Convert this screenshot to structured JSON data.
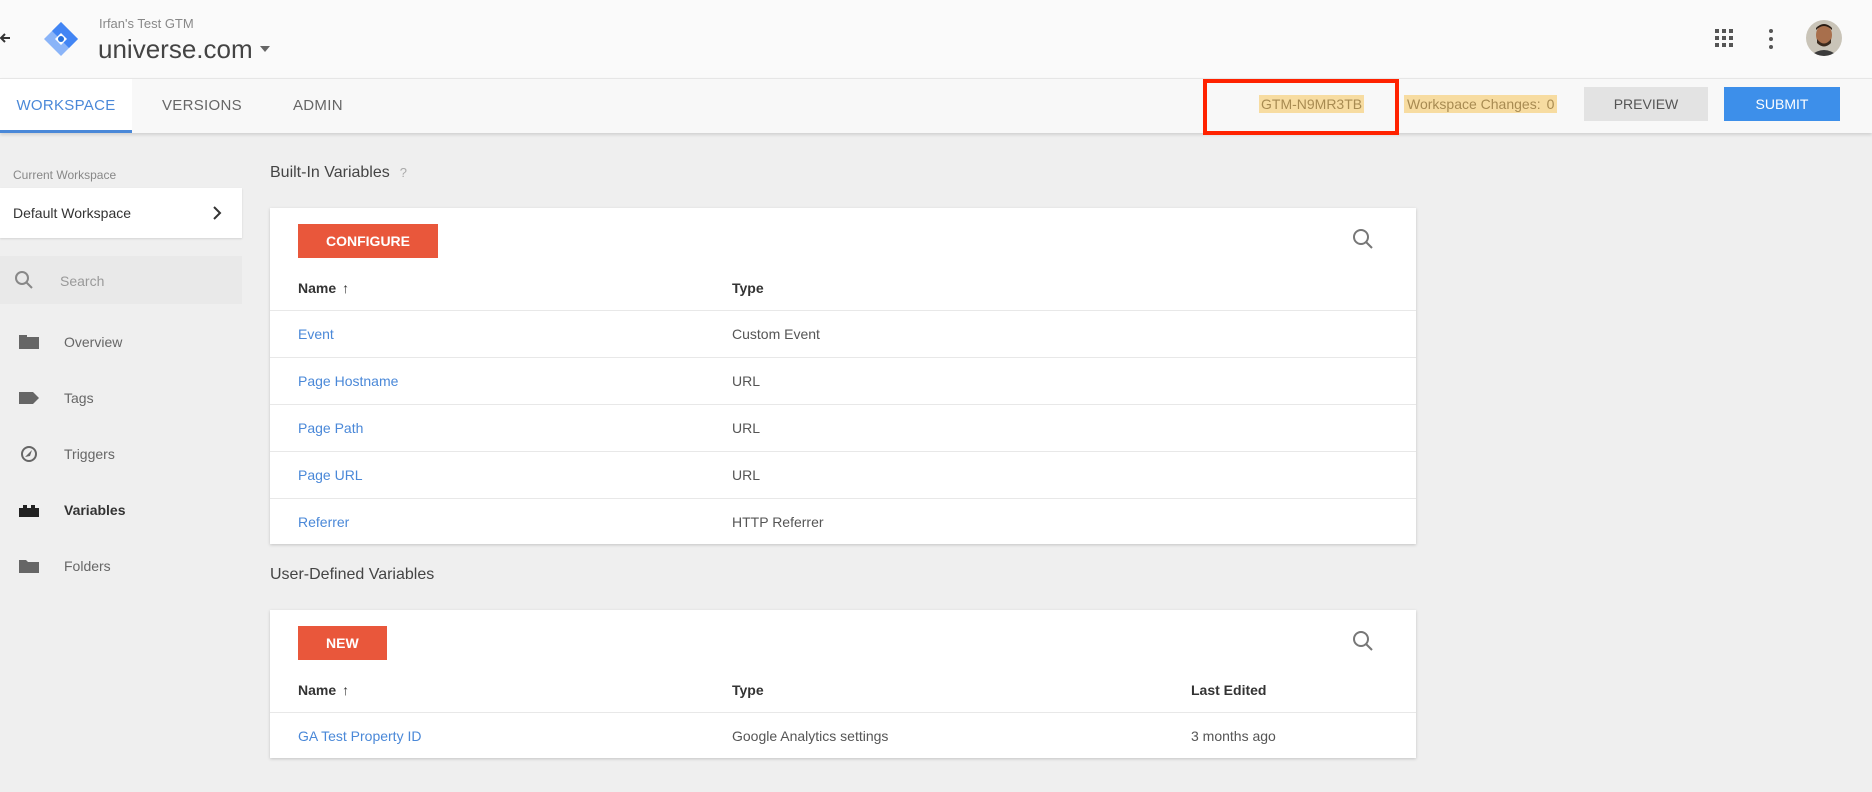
{
  "header": {
    "account_name": "Irfan's Test GTM",
    "container_name": "universe.com"
  },
  "nav": {
    "tabs": [
      {
        "label": "WORKSPACE",
        "active": true
      },
      {
        "label": "VERSIONS",
        "active": false
      },
      {
        "label": "ADMIN",
        "active": false
      }
    ],
    "container_id": "GTM-N9MR3TB",
    "workspace_changes_label": "Workspace Changes:",
    "workspace_changes_count": "0",
    "preview_label": "PREVIEW",
    "submit_label": "SUBMIT"
  },
  "sidebar": {
    "current_workspace_label": "Current Workspace",
    "current_workspace_name": "Default Workspace",
    "search_placeholder": "Search",
    "items": [
      {
        "label": "Overview",
        "icon": "overview-icon"
      },
      {
        "label": "Tags",
        "icon": "tag-icon"
      },
      {
        "label": "Triggers",
        "icon": "trigger-icon"
      },
      {
        "label": "Variables",
        "icon": "variables-icon",
        "active": true
      },
      {
        "label": "Folders",
        "icon": "folder-icon"
      }
    ]
  },
  "builtin": {
    "title": "Built-In Variables",
    "help": "?",
    "button_label": "CONFIGURE",
    "columns": [
      "Name",
      "Type"
    ],
    "sort_arrow": "↑",
    "rows": [
      {
        "name": "Event",
        "type": "Custom Event"
      },
      {
        "name": "Page Hostname",
        "type": "URL"
      },
      {
        "name": "Page Path",
        "type": "URL"
      },
      {
        "name": "Page URL",
        "type": "URL"
      },
      {
        "name": "Referrer",
        "type": "HTTP Referrer"
      }
    ]
  },
  "userdefined": {
    "title": "User-Defined Variables",
    "button_label": "NEW",
    "columns": [
      "Name",
      "Type",
      "Last Edited"
    ],
    "sort_arrow": "↑",
    "rows": [
      {
        "name": "GA Test Property ID",
        "type": "Google Analytics settings",
        "last_edited": "3 months ago"
      }
    ]
  },
  "colors": {
    "accent_blue": "#4a88d8",
    "submit_blue": "#3d8fea",
    "orange": "#e9573b",
    "highlight_red": "#ff2200",
    "highlight_yellow": "#f7dca1"
  }
}
